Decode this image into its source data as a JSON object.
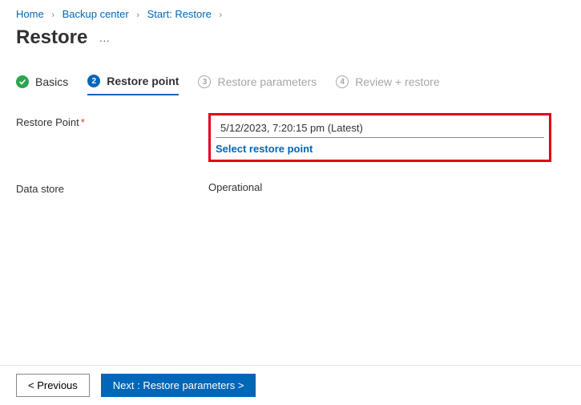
{
  "breadcrumb": {
    "items": [
      "Home",
      "Backup center",
      "Start: Restore"
    ]
  },
  "page": {
    "title": "Restore"
  },
  "wizard": {
    "steps": [
      {
        "label": "Basics",
        "state": "done"
      },
      {
        "num": "2",
        "label": "Restore point",
        "state": "active"
      },
      {
        "num": "3",
        "label": "Restore parameters",
        "state": "pending"
      },
      {
        "num": "4",
        "label": "Review + restore",
        "state": "pending"
      }
    ]
  },
  "form": {
    "restore_point_label": "Restore Point",
    "restore_point_value": "5/12/2023, 7:20:15 pm (Latest)",
    "select_link": "Select restore point",
    "data_store_label": "Data store",
    "data_store_value": "Operational"
  },
  "footer": {
    "previous": "<  Previous",
    "next": "Next : Restore parameters  >"
  }
}
